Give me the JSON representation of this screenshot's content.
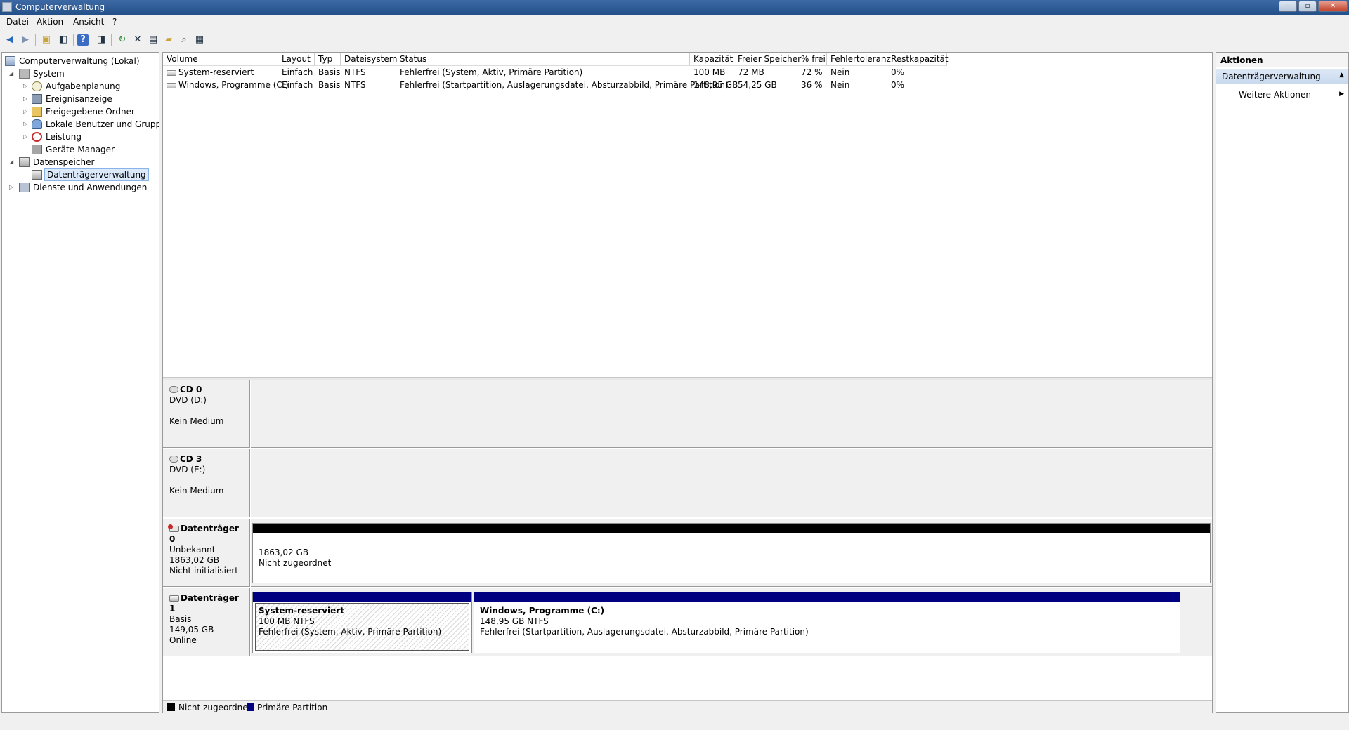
{
  "window": {
    "title": "Computerverwaltung",
    "buttons": [
      "–",
      "▫",
      "✕"
    ]
  },
  "menu": [
    "Datei",
    "Aktion",
    "Ansicht",
    "?"
  ],
  "toolbar": {
    "icons": [
      "back-icon",
      "forward-icon",
      "up-folder-icon",
      "show-hide-tree-icon",
      "help-icon",
      "show-hide-actions-icon",
      "refresh-icon",
      "delete-icon",
      "properties-icon",
      "open-icon",
      "search-icon",
      "settings-icon"
    ]
  },
  "tree": [
    {
      "label": "Computerverwaltung (Lokal)",
      "level": 0,
      "expander": "",
      "icon": "computer-icon"
    },
    {
      "label": "System",
      "level": 1,
      "expander": "◢",
      "icon": "tools-icon"
    },
    {
      "label": "Aufgabenplanung",
      "level": 2,
      "expander": "▷",
      "icon": "clock-icon"
    },
    {
      "label": "Ereignisanzeige",
      "level": 2,
      "expander": "▷",
      "icon": "event-log-icon"
    },
    {
      "label": "Freigegebene Ordner",
      "level": 2,
      "expander": "▷",
      "icon": "shared-folder-icon"
    },
    {
      "label": "Lokale Benutzer und Gruppen",
      "level": 2,
      "expander": "▷",
      "icon": "users-icon"
    },
    {
      "label": "Leistung",
      "level": 2,
      "expander": "▷",
      "icon": "performance-icon"
    },
    {
      "label": "Geräte-Manager",
      "level": 2,
      "expander": "",
      "icon": "device-manager-icon"
    },
    {
      "label": "Datenspeicher",
      "level": 1,
      "expander": "◢",
      "icon": "storage-icon"
    },
    {
      "label": "Datenträgerverwaltung",
      "level": 2,
      "expander": "",
      "icon": "disk-management-icon",
      "selected": true
    },
    {
      "label": "Dienste und Anwendungen",
      "level": 1,
      "expander": "▷",
      "icon": "services-icon"
    }
  ],
  "volumes": {
    "headers": [
      "Volume",
      "Layout",
      "Typ",
      "Dateisystem",
      "Status",
      "Kapazität",
      "Freier Speicher",
      "% frei",
      "Fehlertoleranz",
      "Restkapazität"
    ],
    "rows": [
      [
        "System-reserviert",
        "Einfach",
        "Basis",
        "NTFS",
        "Fehlerfrei (System, Aktiv, Primäre Partition)",
        "100 MB",
        "72 MB",
        "72 %",
        "Nein",
        "0%"
      ],
      [
        "Windows, Programme (C:)",
        "Einfach",
        "Basis",
        "NTFS",
        "Fehlerfrei (Startpartition, Auslagerungsdatei, Absturzabbild, Primäre Partition)",
        "148,95 GB",
        "54,25 GB",
        "36 %",
        "Nein",
        "0%"
      ]
    ]
  },
  "disks": [
    {
      "name": "CD 0",
      "line1": "DVD (D:)",
      "line2": "",
      "line3": "Kein Medium",
      "icon": "cd-drive-icon",
      "partitions": []
    },
    {
      "name": "CD 3",
      "line1": "DVD (E:)",
      "line2": "",
      "line3": "Kein Medium",
      "icon": "cd-drive-icon",
      "partitions": []
    },
    {
      "name": "Datenträger 0",
      "line1": "Unbekannt",
      "line2": "1863,02 GB",
      "line3": "Nicht initialisiert",
      "icon": "disk-error-icon",
      "partitions": [
        {
          "title": "",
          "size": "1863,02 GB",
          "status": "Nicht zugeordnet",
          "bar_color": "#000000",
          "hatched": false,
          "share": 1.0
        }
      ]
    },
    {
      "name": "Datenträger 1",
      "line1": "Basis",
      "line2": "149,05 GB",
      "line3": "Online",
      "icon": "disk-icon",
      "partitions": [
        {
          "title": "System-reserviert",
          "size": "100 MB NTFS",
          "status": "Fehlerfrei (System, Aktiv, Primäre Partition)",
          "bar_color": "#000080",
          "hatched": true
        },
        {
          "title": "Windows, Programme  (C:)",
          "size": "148,95 GB NTFS",
          "status": "Fehlerfrei (Startpartition, Auslagerungsdatei, Absturzabbild, Primäre Partition)",
          "bar_color": "#000080",
          "hatched": false
        }
      ]
    }
  ],
  "legend": [
    {
      "label": "Nicht zugeordnet",
      "color": "#000000"
    },
    {
      "label": "Primäre Partition",
      "color": "#000080"
    }
  ],
  "actions": {
    "title": "Aktionen",
    "section": "Datenträgerverwaltung",
    "item": "Weitere Aktionen"
  }
}
